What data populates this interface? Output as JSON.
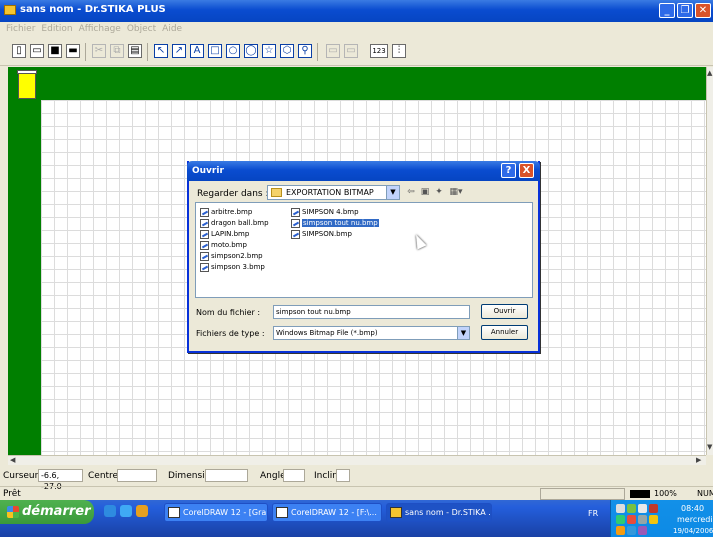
{
  "window": {
    "title": "sans nom - Dr.STIKA PLUS"
  },
  "menu": [
    "Fichier",
    "Edition",
    "Affichage",
    "Object",
    "Aide"
  ],
  "toolbar_icons": [
    "new-icon",
    "open-icon",
    "save-icon",
    "print-icon",
    "cut-icon",
    "copy-icon",
    "paste-icon",
    "pointer-icon",
    "node-icon",
    "text-icon",
    "rectangle-icon",
    "ellipse-icon",
    "star-icon",
    "polygon-icon",
    "zoom-icon",
    "import-icon",
    "export-icon",
    "counter-icon",
    "ruler-icon"
  ],
  "toolbar_text": {
    "text_tool": "A",
    "counter": "123"
  },
  "dialog": {
    "title": "Ouvrir",
    "look_in_label": "Regarder dans :",
    "look_in_value": "EXPORTATION BITMAP",
    "files": [
      "arbitre.bmp",
      "dragon ball.bmp",
      "LAPIN.bmp",
      "moto.bmp",
      "simpson2.bmp",
      "simpson 3.bmp",
      "SIMPSON 4.bmp",
      "simpson tout nu.bmp",
      "SIMPSON.bmp"
    ],
    "selected_file": "simpson tout nu.bmp",
    "filename_label": "Nom du fichier :",
    "filename_value": "simpson tout nu.bmp",
    "filetype_label": "Fichiers de type :",
    "filetype_value": "Windows Bitmap File (*.bmp)",
    "open_button": "Ouvrir",
    "cancel_button": "Annuler",
    "help_button": "?",
    "close_button": "X"
  },
  "status": {
    "cursor_label": "Curseur",
    "cursor_value": "-6.6, -27.0",
    "centre_label": "Centre",
    "dimension_label": "Dimension",
    "angle_label": "Angle",
    "incliner_label": "Incliner",
    "ready": "Prêt",
    "zoom": "100%",
    "num": "NUM"
  },
  "taskbar": {
    "start": "démarrer",
    "tasks": [
      "CorelDRAW 12 - [Gra...",
      "CorelDRAW 12 - [F:\\...",
      "sans nom - Dr.STIKA ..."
    ],
    "lang": "FR",
    "time": "08:40",
    "day": "mercredi",
    "date": "19/04/2006"
  }
}
